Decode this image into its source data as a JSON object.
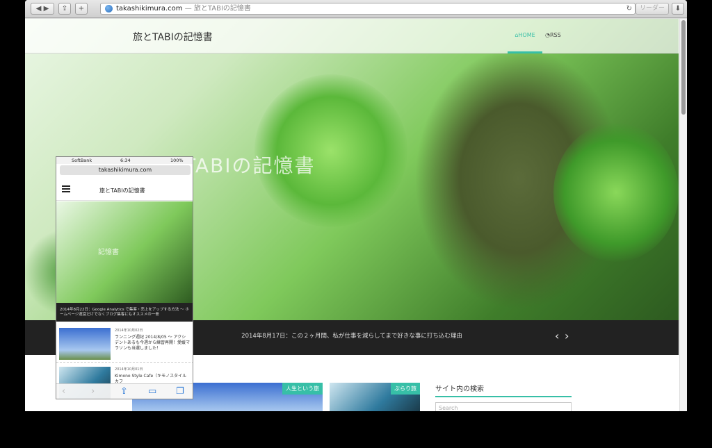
{
  "browser": {
    "back_icon": "back-arrow-icon",
    "forward_icon": "forward-arrow-icon",
    "share_icon": "share-icon",
    "new_tab_label": "+",
    "url_host": "takashikimura.com",
    "url_sep": " — ",
    "url_page_title": "旅とTABIの記憶書",
    "reload_icon": "reload-icon",
    "reader_label": "リーダー",
    "download_icon": "download-icon"
  },
  "site": {
    "title": "旅とTABIの記憶書",
    "nav_home": "HOME",
    "nav_rss": "RSS",
    "hero_title": "TABIの記憶書",
    "slide_caption": "2014年8月17日：この２ヶ月間、私が仕事を減らしてまで好きな事に打ち込む理由",
    "prev_icon": "chevron-left-icon",
    "next_icon": "chevron-right-icon",
    "card1_badge": "人生という旅",
    "card2_badge": "ぶらり旅",
    "search_heading": "サイト内の検索",
    "search_placeholder": "Search"
  },
  "phone": {
    "carrier": "SoftBank",
    "time": "6:34",
    "battery": "100%",
    "url": "takashikimura.com",
    "site_title": "旅とTABIの記憶書",
    "hero_title": "記憶書",
    "slide_caption": "2014年8月22日：Google Analytics で集客・売上をアップする方法 〜 ホームページ運営だけでなくブログ集客にもオススメの一冊",
    "items": [
      {
        "date": "2014年10月02日",
        "text": "ランニング週記 2014/8/05 〜 アクシデントあるも今週から練習再開！愛媛マラソンも当選しました！"
      },
      {
        "date": "2014年10月01日",
        "text": "Kimono Style Cafe（キモノスタイルカフ"
      }
    ]
  },
  "colors": {
    "accent": "#37bfa7",
    "strip": "#222222"
  }
}
